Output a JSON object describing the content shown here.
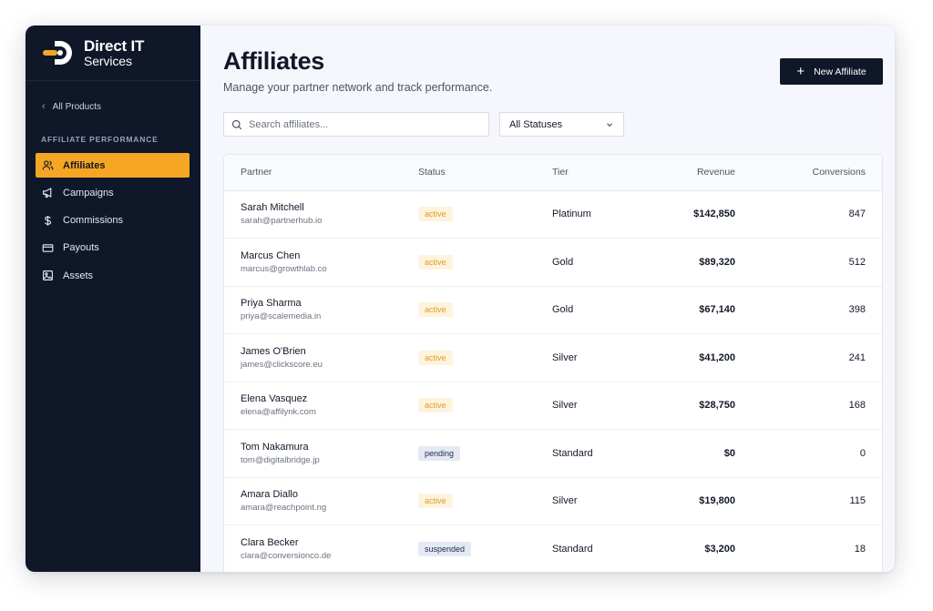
{
  "brand": {
    "name": "Direct IT",
    "sub": "Services",
    "colors": {
      "accent": "#f5a623",
      "sidebar": "#0f1729"
    }
  },
  "sidebar": {
    "back_label": "All Products",
    "section_label": "AFFILIATE PERFORMANCE",
    "items": [
      {
        "label": "Affiliates",
        "icon": "users-icon",
        "active": true
      },
      {
        "label": "Campaigns",
        "icon": "megaphone-icon",
        "active": false
      },
      {
        "label": "Commissions",
        "icon": "dollar-icon",
        "active": false
      },
      {
        "label": "Payouts",
        "icon": "credit-card-icon",
        "active": false
      },
      {
        "label": "Assets",
        "icon": "image-icon",
        "active": false
      }
    ]
  },
  "main": {
    "title": "Affiliates",
    "subtitle": "Manage your partner network and track performance.",
    "new_button": "New Affiliate",
    "search_placeholder": "Search affiliates...",
    "status_filter": "All Statuses"
  },
  "table": {
    "columns": [
      "Partner",
      "Status",
      "Tier",
      "Revenue",
      "Conversions"
    ],
    "rows": [
      {
        "name": "Sarah Mitchell",
        "email": "sarah@partnerhub.io",
        "status": "active",
        "tier": "Platinum",
        "revenue": "$142,850",
        "conversions": "847"
      },
      {
        "name": "Marcus Chen",
        "email": "marcus@growthlab.co",
        "status": "active",
        "tier": "Gold",
        "revenue": "$89,320",
        "conversions": "512"
      },
      {
        "name": "Priya Sharma",
        "email": "priya@scalemedia.in",
        "status": "active",
        "tier": "Gold",
        "revenue": "$67,140",
        "conversions": "398"
      },
      {
        "name": "James O'Brien",
        "email": "james@clickscore.eu",
        "status": "active",
        "tier": "Silver",
        "revenue": "$41,200",
        "conversions": "241"
      },
      {
        "name": "Elena Vasquez",
        "email": "elena@affilynk.com",
        "status": "active",
        "tier": "Silver",
        "revenue": "$28,750",
        "conversions": "168"
      },
      {
        "name": "Tom Nakamura",
        "email": "tom@digitalbridge.jp",
        "status": "pending",
        "tier": "Standard",
        "revenue": "$0",
        "conversions": "0"
      },
      {
        "name": "Amara Diallo",
        "email": "amara@reachpoint.ng",
        "status": "active",
        "tier": "Silver",
        "revenue": "$19,800",
        "conversions": "115"
      },
      {
        "name": "Clara Becker",
        "email": "clara@conversionco.de",
        "status": "suspended",
        "tier": "Standard",
        "revenue": "$3,200",
        "conversions": "18"
      }
    ]
  }
}
